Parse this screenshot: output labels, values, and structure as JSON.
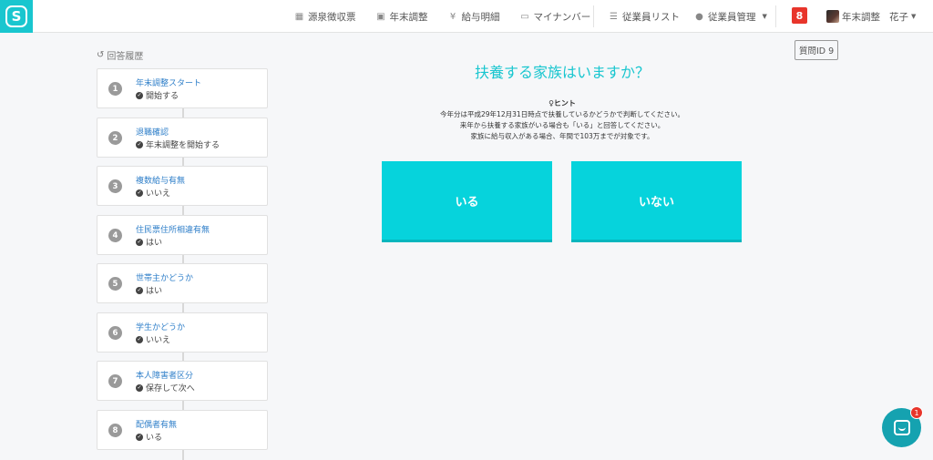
{
  "header": {
    "nav": [
      {
        "label": "源泉徴収票",
        "icon": "calculator-icon"
      },
      {
        "label": "年末調整",
        "icon": "calendar-icon"
      },
      {
        "label": "給与明細",
        "icon": "yen-icon"
      },
      {
        "label": "マイナンバー",
        "icon": "id-card-icon"
      }
    ],
    "employee_list": {
      "label": "従業員リスト",
      "icon": "list-icon"
    },
    "employee_manage": {
      "label": "従業員管理",
      "icon": "user-icon"
    },
    "notification_count": "8",
    "user": {
      "org": "年末調整",
      "name": "花子"
    }
  },
  "history": {
    "title": "回答履歴",
    "items": [
      {
        "num": "1",
        "question": "年末調整スタート",
        "answer": "開始する"
      },
      {
        "num": "2",
        "question": "退職確認",
        "answer": "年末調整を開始する"
      },
      {
        "num": "3",
        "question": "複数給与有無",
        "answer": "いいえ"
      },
      {
        "num": "4",
        "question": "住民票住所相違有無",
        "answer": "はい"
      },
      {
        "num": "5",
        "question": "世帯主かどうか",
        "answer": "はい"
      },
      {
        "num": "6",
        "question": "学生かどうか",
        "answer": "いいえ"
      },
      {
        "num": "7",
        "question": "本人障害者区分",
        "answer": "保存して次へ"
      },
      {
        "num": "8",
        "question": "配偶者有無",
        "answer": "いる"
      }
    ]
  },
  "main": {
    "question_id": "質問ID 9",
    "title": "扶養する家族はいますか？",
    "hint_label": "ヒント",
    "hint_lines": [
      "今年分は平成29年12月31日時点で扶養しているかどうかで判断してください。",
      "来年から扶養する家族がいる場合も「いる」と回答してください。",
      "家族に給与収入がある場合、年間で103万までが対象です。"
    ],
    "choice_yes": "いる",
    "choice_no": "いない"
  },
  "chat": {
    "badge": "1"
  },
  "colors": {
    "accent": "#19c6cf",
    "button": "#06d3dc",
    "badge": "#e8352b",
    "link": "#2f7fc9"
  }
}
